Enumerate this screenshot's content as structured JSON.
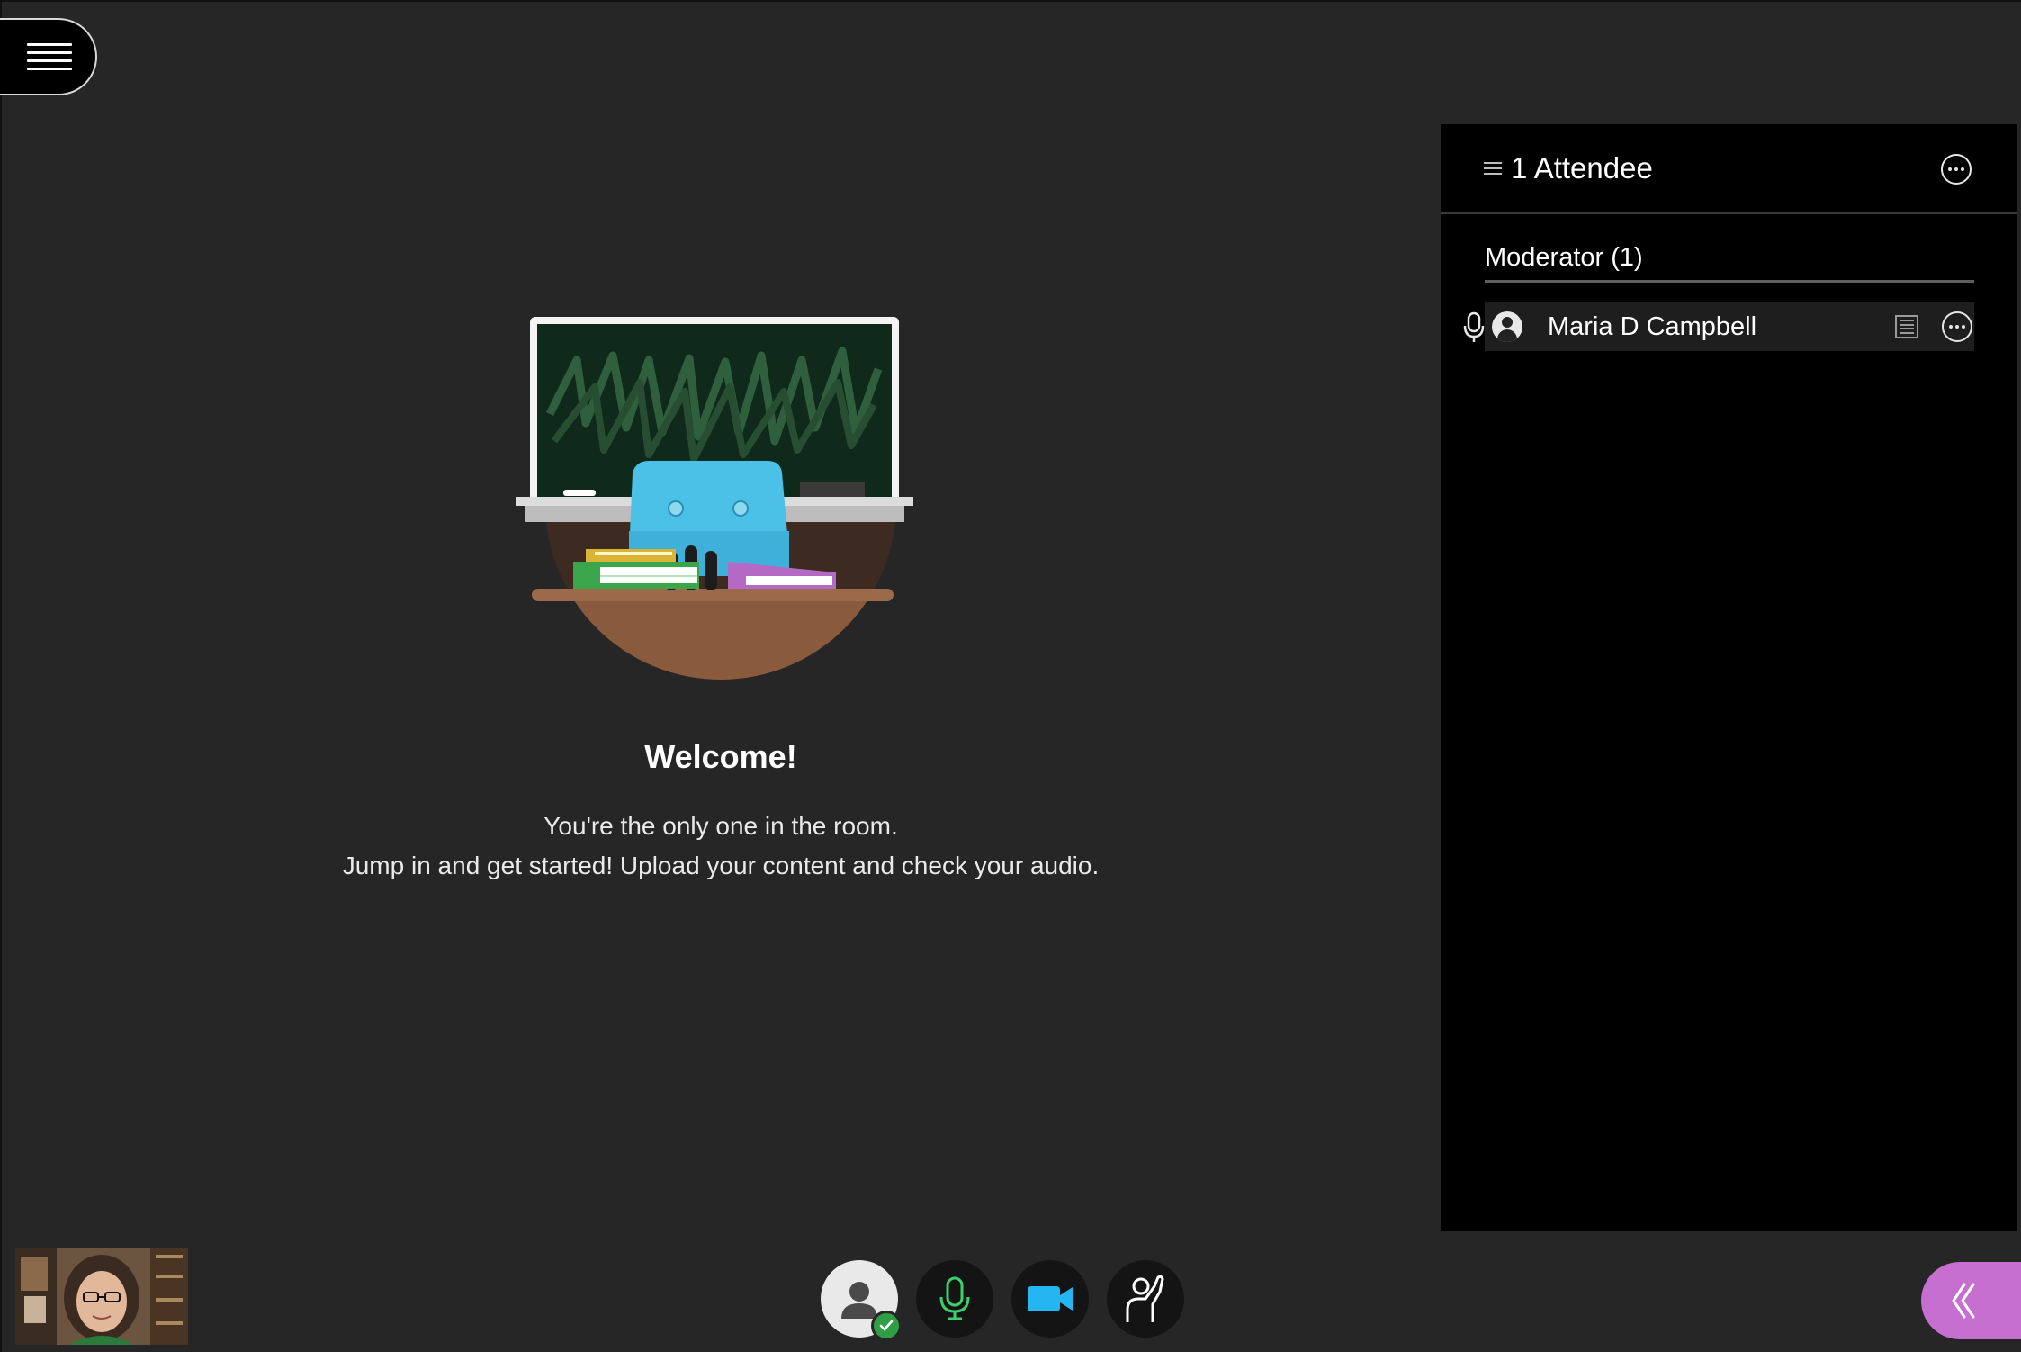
{
  "menu": {
    "icon": "hamburger-menu-icon"
  },
  "welcome": {
    "title": "Welcome!",
    "line1": "You're the only one in the room.",
    "line2": "Jump in and get started! Upload your content and check your audio."
  },
  "attendees_panel": {
    "title": "1 Attendee",
    "groups": [
      {
        "label": "Moderator (1)",
        "members": [
          {
            "name": "Maria D Campbell",
            "audio": "microphone-icon",
            "status": "avatar"
          }
        ]
      }
    ]
  },
  "controls": [
    {
      "id": "profile",
      "icon": "user-avatar-icon",
      "status": "ready"
    },
    {
      "id": "microphone",
      "icon": "microphone-icon",
      "color": "#3bd16f"
    },
    {
      "id": "camera",
      "icon": "video-camera-icon",
      "color": "#23b6f0"
    },
    {
      "id": "raise-hand",
      "icon": "raise-hand-icon"
    }
  ],
  "colors": {
    "background": "#262626",
    "panel": "#000000",
    "accent_purple": "#c66fd0",
    "mic_green": "#3bd16f",
    "camera_blue": "#23b6f0"
  }
}
